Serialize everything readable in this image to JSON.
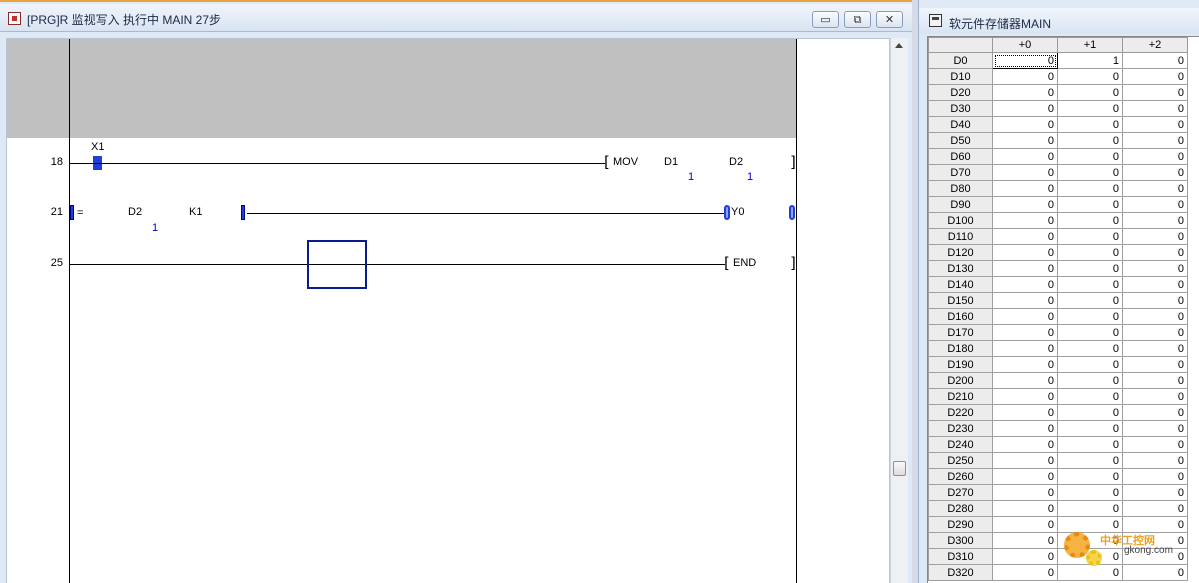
{
  "ladder_window": {
    "title": "[PRG]R 监视写入 执行中 MAIN 27步",
    "buttons": {
      "minimize": "▭",
      "restore": "⧉",
      "close": "✕"
    },
    "rungs": [
      {
        "step": "18",
        "contact": {
          "device": "X1",
          "state": "on"
        },
        "instruction": {
          "name": "MOV",
          "operands": [
            "D1",
            "D2"
          ],
          "values": [
            "1",
            "1"
          ]
        }
      },
      {
        "step": "21",
        "compare": {
          "op": "=",
          "operands": [
            "D2",
            "K1"
          ],
          "values": [
            "1"
          ]
        },
        "coil": {
          "device": "Y0",
          "state": "on"
        }
      },
      {
        "step": "25",
        "instruction": {
          "name": "END"
        }
      }
    ]
  },
  "memory_window": {
    "title": "软元件存储器MAIN",
    "columns": [
      "",
      "+0",
      "+1",
      "+2"
    ],
    "rows": [
      [
        "D0",
        "0",
        "1",
        "0"
      ],
      [
        "D10",
        "0",
        "0",
        "0"
      ],
      [
        "D20",
        "0",
        "0",
        "0"
      ],
      [
        "D30",
        "0",
        "0",
        "0"
      ],
      [
        "D40",
        "0",
        "0",
        "0"
      ],
      [
        "D50",
        "0",
        "0",
        "0"
      ],
      [
        "D60",
        "0",
        "0",
        "0"
      ],
      [
        "D70",
        "0",
        "0",
        "0"
      ],
      [
        "D80",
        "0",
        "0",
        "0"
      ],
      [
        "D90",
        "0",
        "0",
        "0"
      ],
      [
        "D100",
        "0",
        "0",
        "0"
      ],
      [
        "D110",
        "0",
        "0",
        "0"
      ],
      [
        "D120",
        "0",
        "0",
        "0"
      ],
      [
        "D130",
        "0",
        "0",
        "0"
      ],
      [
        "D140",
        "0",
        "0",
        "0"
      ],
      [
        "D150",
        "0",
        "0",
        "0"
      ],
      [
        "D160",
        "0",
        "0",
        "0"
      ],
      [
        "D170",
        "0",
        "0",
        "0"
      ],
      [
        "D180",
        "0",
        "0",
        "0"
      ],
      [
        "D190",
        "0",
        "0",
        "0"
      ],
      [
        "D200",
        "0",
        "0",
        "0"
      ],
      [
        "D210",
        "0",
        "0",
        "0"
      ],
      [
        "D220",
        "0",
        "0",
        "0"
      ],
      [
        "D230",
        "0",
        "0",
        "0"
      ],
      [
        "D240",
        "0",
        "0",
        "0"
      ],
      [
        "D250",
        "0",
        "0",
        "0"
      ],
      [
        "D260",
        "0",
        "0",
        "0"
      ],
      [
        "D270",
        "0",
        "0",
        "0"
      ],
      [
        "D280",
        "0",
        "0",
        "0"
      ],
      [
        "D290",
        "0",
        "0",
        "0"
      ],
      [
        "D300",
        "0",
        "0",
        "0"
      ],
      [
        "D310",
        "0",
        "0",
        "0"
      ],
      [
        "D320",
        "0",
        "0",
        "0"
      ]
    ]
  },
  "watermark": {
    "text": "中华工控网",
    "sub": "gkong.com"
  },
  "colors": {
    "accent": "#e8a33c",
    "active_blue": "#1f3fd8",
    "monitor_value": "#0000c8",
    "grey_band": "#c0c0c0"
  }
}
